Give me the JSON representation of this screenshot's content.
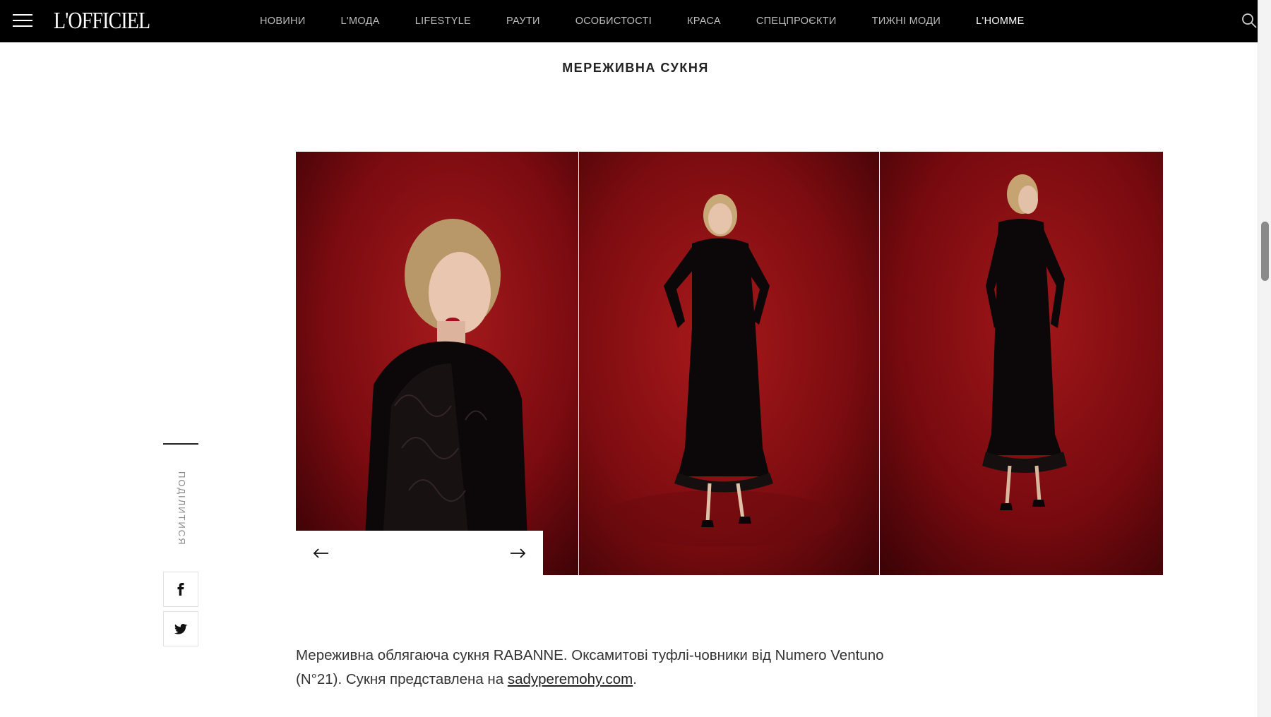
{
  "header": {
    "logo": "L'OFFICIEL",
    "nav": [
      {
        "label": "НОВИНИ"
      },
      {
        "label": "L'МОДА"
      },
      {
        "label": "LIFESTYLE"
      },
      {
        "label": "РАУТИ"
      },
      {
        "label": "ОСОБИСТОСТІ"
      },
      {
        "label": "КРАСА"
      },
      {
        "label": "СПЕЦПРОЄКТИ"
      },
      {
        "label": "ТИЖНІ МОДИ"
      },
      {
        "label": "L'HOMME",
        "active": true
      }
    ],
    "icons": {
      "menu": "hamburger-icon",
      "search": "search-icon"
    }
  },
  "article": {
    "section_title": "МЕРЕЖИВНА СУКНЯ",
    "share_label": "ПОДІЛИТИСЯ",
    "caption_part1": "Мереживна облягаюча сукня RABANNE. Оксамитові туфлі-човники від Numero Ventuno (N°21). Сукня представлена на ",
    "caption_link": "sadyperemohy.com",
    "caption_end": "."
  },
  "colors": {
    "nav_bg": "#000000",
    "backdrop_red": "#8a0e12"
  }
}
